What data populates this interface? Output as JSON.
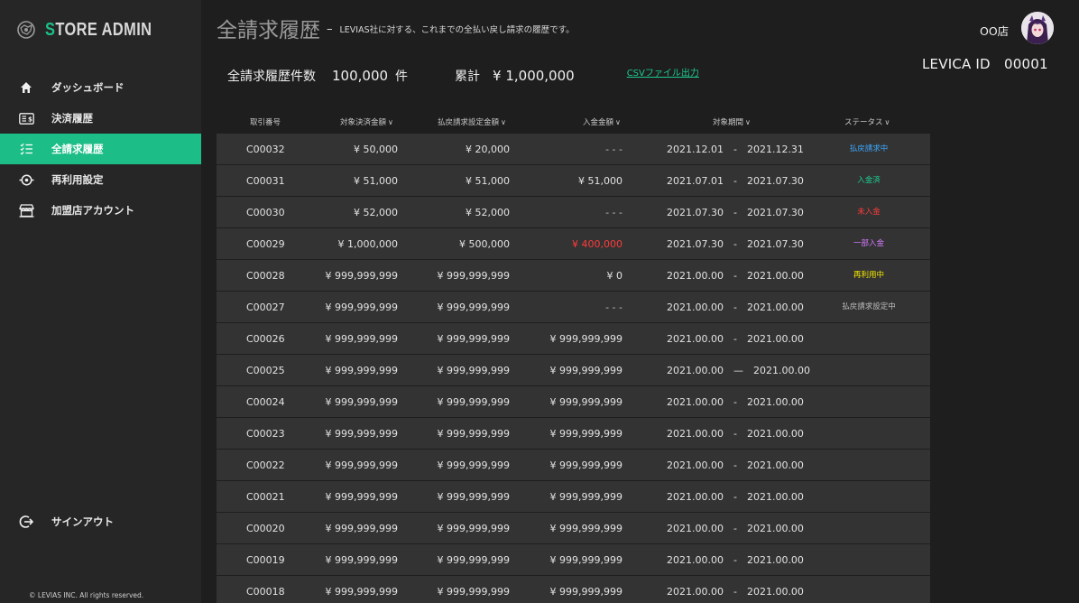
{
  "app": {
    "logo_prefix": "S",
    "logo_rest": "TORE ADMIN"
  },
  "sidebar": {
    "items": [
      {
        "label": "ダッシュボード",
        "icon": "home-icon",
        "active": false
      },
      {
        "label": "決済履歴",
        "icon": "payment-history-icon",
        "active": false
      },
      {
        "label": "全請求履歴",
        "icon": "checklist-icon",
        "active": true
      },
      {
        "label": "再利用設定",
        "icon": "reuse-settings-icon",
        "active": false
      },
      {
        "label": "加盟店アカウント",
        "icon": "store-icon",
        "active": false
      }
    ],
    "signout_label": "サインアウト",
    "copyright": "© LEVIAS INC. All rights reserved."
  },
  "header": {
    "title": "全請求履歴",
    "dash": "–",
    "description": "LEVIAS社に対する、これまでの全払い戻し請求の履歴です。",
    "store_name": "OO店",
    "levica_id": "LEVICA ID　00001"
  },
  "summary": {
    "count_label": "全請求履歴件数",
    "count_value": "100,000",
    "count_unit": "件",
    "total_label": "累計",
    "total_value": "¥ 1,000,000",
    "csv_label": "CSVファイル出力"
  },
  "table": {
    "columns": {
      "id": "取引番号",
      "pay": "対象決済金額",
      "refund": "払戻請求設定金額",
      "recv": "入金金額",
      "period": "対象期間",
      "status": "ステータス"
    },
    "rows": [
      {
        "id": "C00032",
        "pay": "¥ 50,000",
        "refund": "¥ 20,000",
        "recv": "- - -",
        "period": "2021.12.01　-　2021.12.31",
        "status": "払戻請求中",
        "status_color": "#3da8ff",
        "recv_color": "#bdbdbd"
      },
      {
        "id": "C00031",
        "pay": "¥ 51,000",
        "refund": "¥ 51,000",
        "recv": "¥ 51,000",
        "period": "2021.07.01　-　2021.07.30",
        "status": "入金済",
        "status_color": "#1cd08f",
        "recv_color": "#e2e2e2"
      },
      {
        "id": "C00030",
        "pay": "¥ 52,000",
        "refund": "¥ 52,000",
        "recv": "- - -",
        "period": "2021.07.30　-　2021.07.30",
        "status": "未入金",
        "status_color": "#ff3b3b",
        "recv_color": "#bdbdbd"
      },
      {
        "id": "C00029",
        "pay": "¥ 1,000,000",
        "refund": "¥ 500,000",
        "recv": "¥ 400,000",
        "period": "2021.07.30　-　2021.07.30",
        "status": "一部入金",
        "status_color": "#d57bff",
        "recv_color": "#ff3b3b"
      },
      {
        "id": "C00028",
        "pay": "¥ 999,999,999",
        "refund": "¥ 999,999,999",
        "recv": "¥ 0",
        "period": "2021.00.00　-　2021.00.00",
        "status": "再利用中",
        "status_color": "#f2e600",
        "recv_color": "#e2e2e2"
      },
      {
        "id": "C00027",
        "pay": "¥ 999,999,999",
        "refund": "¥ 999,999,999",
        "recv": "- - -",
        "period": "2021.00.00　-　2021.00.00",
        "status": "払戻請求設定中",
        "status_color": "#bdbdbd",
        "recv_color": "#bdbdbd"
      },
      {
        "id": "C00026",
        "pay": "¥ 999,999,999",
        "refund": "¥ 999,999,999",
        "recv": "¥ 999,999,999",
        "period": "2021.00.00　-　2021.00.00",
        "status": "",
        "status_color": "#bdbdbd",
        "recv_color": "#e2e2e2"
      },
      {
        "id": "C00025",
        "pay": "¥ 999,999,999",
        "refund": "¥ 999,999,999",
        "recv": "¥ 999,999,999",
        "period": "2021.00.00　—　2021.00.00",
        "status": "",
        "status_color": "#bdbdbd",
        "recv_color": "#e2e2e2"
      },
      {
        "id": "C00024",
        "pay": "¥ 999,999,999",
        "refund": "¥ 999,999,999",
        "recv": "¥ 999,999,999",
        "period": "2021.00.00　-　2021.00.00",
        "status": "",
        "status_color": "#bdbdbd",
        "recv_color": "#e2e2e2"
      },
      {
        "id": "C00023",
        "pay": "¥ 999,999,999",
        "refund": "¥ 999,999,999",
        "recv": "¥ 999,999,999",
        "period": "2021.00.00　-　2021.00.00",
        "status": "",
        "status_color": "#bdbdbd",
        "recv_color": "#e2e2e2"
      },
      {
        "id": "C00022",
        "pay": "¥ 999,999,999",
        "refund": "¥ 999,999,999",
        "recv": "¥ 999,999,999",
        "period": "2021.00.00　-　2021.00.00",
        "status": "",
        "status_color": "#bdbdbd",
        "recv_color": "#e2e2e2"
      },
      {
        "id": "C00021",
        "pay": "¥ 999,999,999",
        "refund": "¥ 999,999,999",
        "recv": "¥ 999,999,999",
        "period": "2021.00.00　-　2021.00.00",
        "status": "",
        "status_color": "#bdbdbd",
        "recv_color": "#e2e2e2"
      },
      {
        "id": "C00020",
        "pay": "¥ 999,999,999",
        "refund": "¥ 999,999,999",
        "recv": "¥ 999,999,999",
        "period": "2021.00.00　-　2021.00.00",
        "status": "",
        "status_color": "#bdbdbd",
        "recv_color": "#e2e2e2"
      },
      {
        "id": "C00019",
        "pay": "¥ 999,999,999",
        "refund": "¥ 999,999,999",
        "recv": "¥ 999,999,999",
        "period": "2021.00.00　-　2021.00.00",
        "status": "",
        "status_color": "#bdbdbd",
        "recv_color": "#e2e2e2"
      },
      {
        "id": "C00018",
        "pay": "¥ 999,999,999",
        "refund": "¥ 999,999,999",
        "recv": "¥ 999,999,999",
        "period": "2021.00.00　-　2021.00.00",
        "status": "",
        "status_color": "#bdbdbd",
        "recv_color": "#e2e2e2"
      }
    ]
  },
  "colors": {
    "accent": "#1cbd87",
    "sidebar_bg": "#262626",
    "row_bg": "#333333",
    "page_bg": "#1e1e1e"
  }
}
